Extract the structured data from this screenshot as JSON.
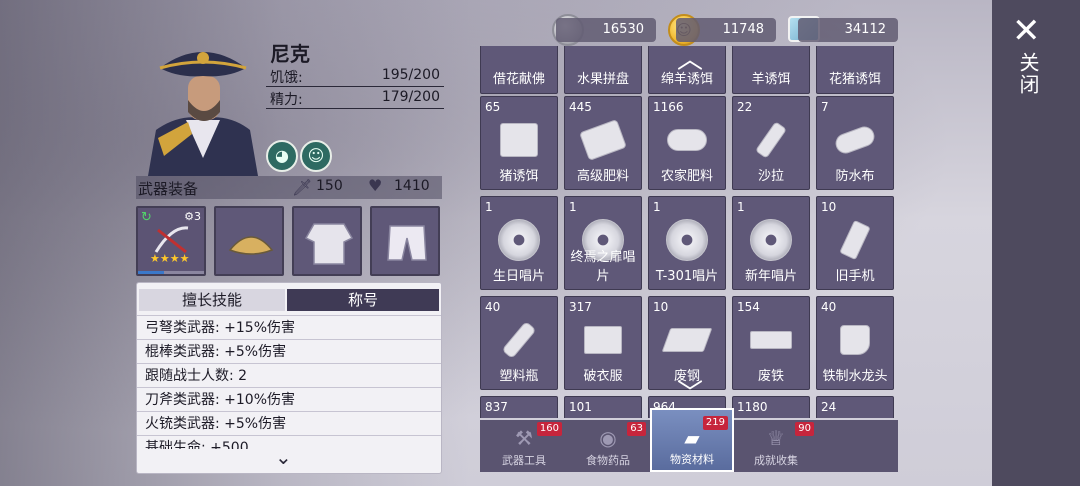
{
  "currency": [
    {
      "name": "silver-coin",
      "value": "16530"
    },
    {
      "name": "gold-coin",
      "value": "11748"
    },
    {
      "name": "ticket",
      "value": "34112"
    }
  ],
  "close_label": "关闭",
  "character": {
    "name": "尼克",
    "stats": [
      {
        "label": "饥饿:",
        "value": "195/200"
      },
      {
        "label": "精力:",
        "value": "179/200"
      }
    ]
  },
  "equipment": {
    "title": "武器装备",
    "attack": "150",
    "health": "1410",
    "weapon_level": "3",
    "weapon_stars": "★★★★"
  },
  "skills_panel": {
    "tab_skill": "擅长技能",
    "tab_title": "称号",
    "rows": [
      "弓弩类武器: +15%伤害",
      "棍棒类武器: +5%伤害",
      "跟随战士人数: 2",
      "刀斧类武器: +10%伤害",
      "火铳类武器: +5%伤害",
      "基础生命: +500"
    ]
  },
  "inventory": {
    "row0": [
      {
        "count": "",
        "label": "借花献佛"
      },
      {
        "count": "",
        "label": "水果拼盘"
      },
      {
        "count": "",
        "label": "绵羊诱饵"
      },
      {
        "count": "",
        "label": "羊诱饵"
      },
      {
        "count": "",
        "label": "花猪诱饵"
      }
    ],
    "row1": [
      {
        "count": "65",
        "label": "猪诱饵"
      },
      {
        "count": "445",
        "label": "高级肥料"
      },
      {
        "count": "1166",
        "label": "农家肥料"
      },
      {
        "count": "22",
        "label": "沙拉"
      },
      {
        "count": "7",
        "label": "防水布"
      }
    ],
    "row2": [
      {
        "count": "1",
        "label": "生日唱片"
      },
      {
        "count": "1",
        "label": "终焉之扉唱片"
      },
      {
        "count": "1",
        "label": "T-301唱片"
      },
      {
        "count": "1",
        "label": "新年唱片"
      },
      {
        "count": "10",
        "label": "旧手机"
      }
    ],
    "row3": [
      {
        "count": "40",
        "label": "塑料瓶"
      },
      {
        "count": "317",
        "label": "破衣服"
      },
      {
        "count": "10",
        "label": "废钢"
      },
      {
        "count": "154",
        "label": "废铁"
      },
      {
        "count": "40",
        "label": "铁制水龙头"
      }
    ],
    "row4": [
      {
        "count": "837",
        "label": ""
      },
      {
        "count": "101",
        "label": ""
      },
      {
        "count": "964",
        "label": ""
      },
      {
        "count": "1180",
        "label": ""
      },
      {
        "count": "24",
        "label": ""
      }
    ]
  },
  "categories": [
    {
      "label": "武器工具",
      "badge": "160"
    },
    {
      "label": "食物药品",
      "badge": "63"
    },
    {
      "label": "物资材料",
      "badge": "219"
    },
    {
      "label": "成就收集",
      "badge": "90"
    }
  ],
  "colors": {
    "tile": "#5f5878",
    "active_tab": "#5a6c9e",
    "badge": "#c6253c",
    "star": "#ffc82a"
  }
}
